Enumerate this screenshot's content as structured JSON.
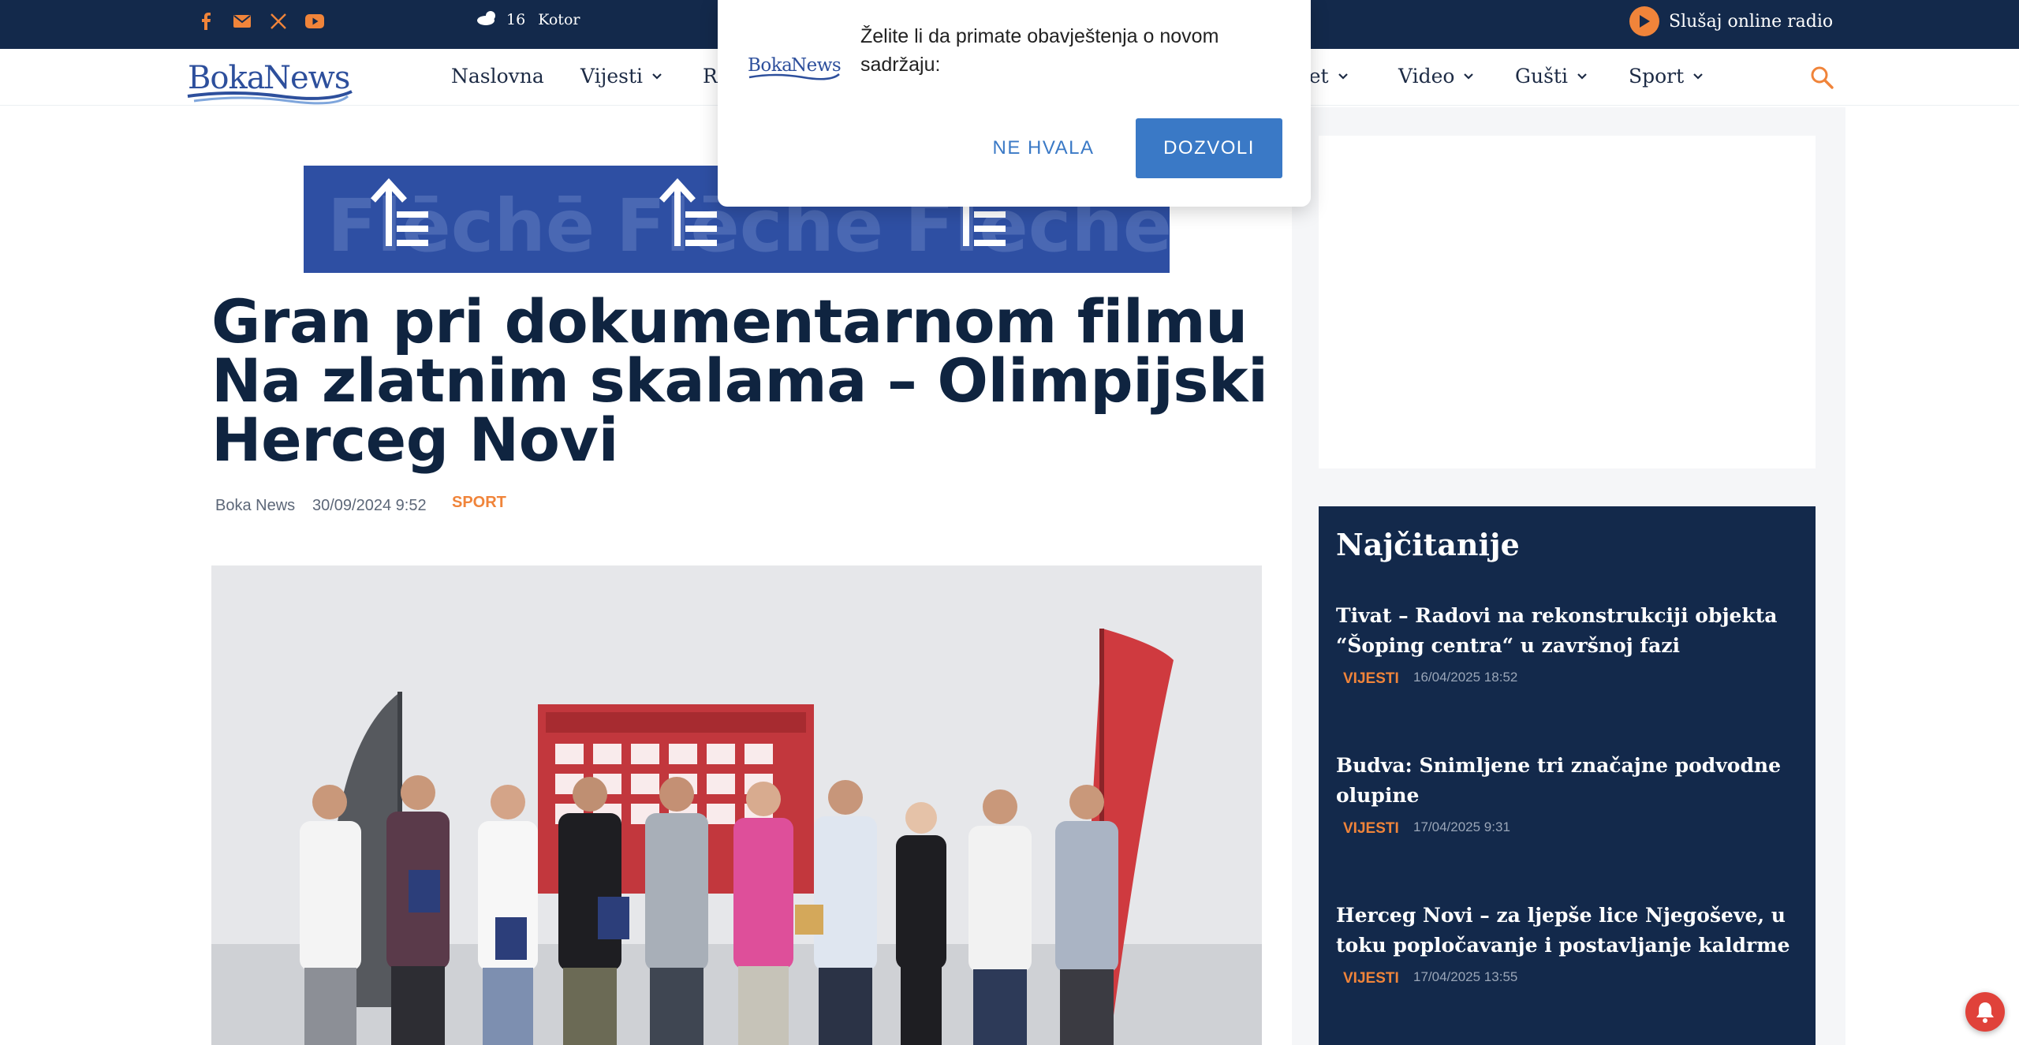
{
  "topbar": {
    "social_icons": [
      "facebook-icon",
      "email-icon",
      "x-icon",
      "youtube-icon"
    ],
    "weather": {
      "temperature": "16",
      "city": "Kotor",
      "icon": "cloud-moon-icon"
    },
    "radio_label": "Slušaj online radio"
  },
  "brand": {
    "logo_text_1": "Boka",
    "logo_text_2": "News"
  },
  "nav": {
    "items": [
      {
        "label": "Naslovna",
        "dropdown": false
      },
      {
        "label": "Vijesti",
        "dropdown": true
      },
      {
        "label": "Ro",
        "dropdown": false
      },
      {
        "label": "jet",
        "dropdown": true
      },
      {
        "label": "Video",
        "dropdown": true
      },
      {
        "label": "Gušti",
        "dropdown": true
      },
      {
        "label": "Sport",
        "dropdown": true
      }
    ]
  },
  "article": {
    "title": "Gran pri dokumentarnom filmu Na zlatnim skalama – Olimpijski Herceg Novi",
    "author": "Boka News",
    "date": "30/09/2024 9:52",
    "category": "SPORT"
  },
  "ad": {
    "banner_text": "Flēchē"
  },
  "most_read": {
    "heading": "Najčitanije",
    "items": [
      {
        "title": "Tivat – Radovi na rekonstrukciji objekta “Šoping centra“ u završnoj fazi",
        "category": "VIJESTI",
        "date": "16/04/2025 18:52"
      },
      {
        "title": "Budva: Snimljene tri značajne podvodne olupine",
        "category": "VIJESTI",
        "date": "17/04/2025 9:31"
      },
      {
        "title": "Herceg Novi – za ljepše lice Njegoševe, u toku popločavanje i postavljanje kaldrme",
        "category": "VIJESTI",
        "date": "17/04/2025 13:55"
      }
    ]
  },
  "notification": {
    "message": "Želite li da primate obavještenja o novom sadržaju:",
    "decline_label": "NE HVALA",
    "allow_label": "DOZVOLI"
  },
  "colors": {
    "navy": "#13294b",
    "accent": "#f0843a",
    "button_blue": "#3a79c6"
  }
}
